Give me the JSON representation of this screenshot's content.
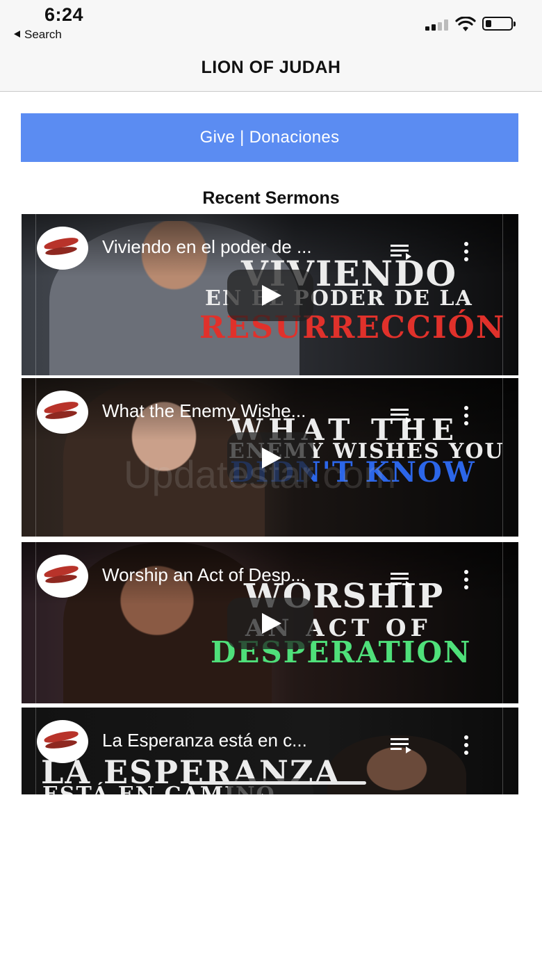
{
  "status_bar": {
    "time": "6:24",
    "back_label": "Search"
  },
  "nav": {
    "title": "LION OF JUDAH"
  },
  "give_button": {
    "label": "Give | Donaciones",
    "color": "#5b8cf2"
  },
  "section": {
    "title": "Recent Sermons"
  },
  "videos": [
    {
      "title": "Viviendo en el poder de ...",
      "overlay_lines": [
        "VIVIENDO",
        "EN EL PODER DE LA",
        "RESURRECCIÓN"
      ]
    },
    {
      "title": "What the Enemy Wishe...",
      "overlay_lines": [
        "WHAT THE",
        "ENEMY WISHES YOU",
        "DIDN'T KNOW"
      ]
    },
    {
      "title": "Worship an Act of Desp...",
      "overlay_lines": [
        "WORSHIP",
        "AN ACT OF",
        "DESPERATION"
      ]
    },
    {
      "title": "La Esperanza está en c...",
      "overlay_lines": [
        "LA ESPERANZA",
        "ESTÁ EN CAMINO"
      ]
    }
  ],
  "watermark": "Updatestar.com",
  "icons": {
    "channel_logo": "eagle-logo-icon",
    "queue": "add-to-queue-icon",
    "more": "more-vertical-icon",
    "play": "play-icon"
  }
}
